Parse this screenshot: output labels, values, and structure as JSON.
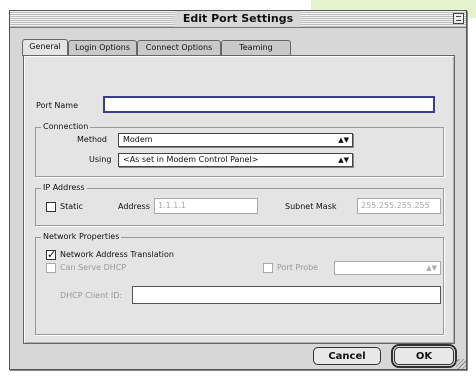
{
  "window": {
    "title": "Edit Port Settings"
  },
  "tabs": [
    {
      "label": "General"
    },
    {
      "label": "Login Options"
    },
    {
      "label": "Connect Options"
    },
    {
      "label": "Teaming"
    }
  ],
  "general": {
    "port_name_label": "Port Name",
    "port_name_value": "",
    "connection": {
      "title": "Connection",
      "method_label": "Method",
      "method_value": "Modem",
      "using_label": "Using",
      "using_value": "<As set in Modem Control Panel>"
    },
    "ip": {
      "title": "IP Address",
      "static_label": "Static",
      "static_checked": false,
      "address_label": "Address",
      "address_value": "1.1.1.1",
      "subnet_label": "Subnet Mask",
      "subnet_value": "255.255.255.255"
    },
    "network": {
      "title": "Network Properties",
      "nat_label": "Network Address Translation",
      "nat_checked": true,
      "dhcp_label": "Can Serve DHCP",
      "port_probe_label": "Port Probe",
      "port_probe_value": "",
      "dhcp_client_label": "DHCP Client ID:",
      "dhcp_client_value": ""
    }
  },
  "buttons": {
    "cancel": "Cancel",
    "ok": "OK"
  },
  "colors": {
    "accent_bg": "#e6f3cf",
    "focus_ring": "#3a3f8c"
  }
}
